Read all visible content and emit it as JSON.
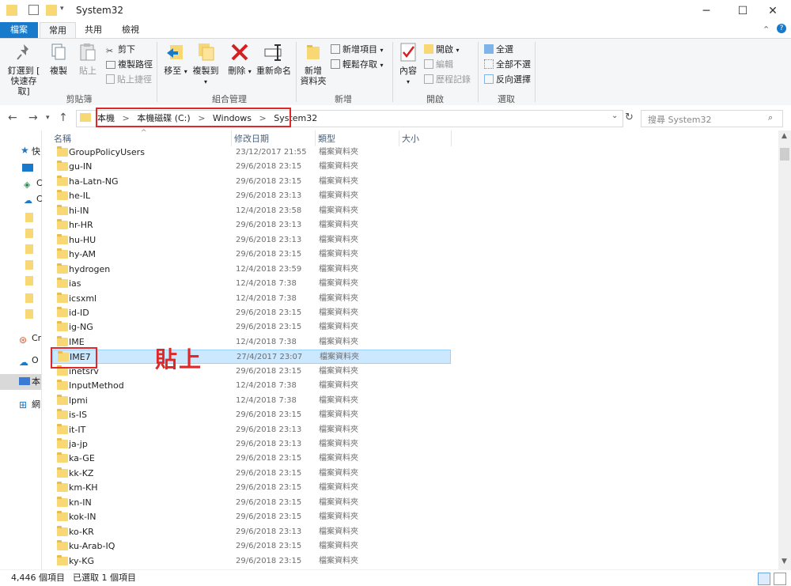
{
  "window": {
    "title": "System32"
  },
  "ribbon_tabs": {
    "file": "檔案",
    "home": "常用",
    "share": "共用",
    "view": "檢視"
  },
  "ribbon": {
    "clipboard": {
      "pin_line1": "釘選到 [",
      "pin_line2": "快速存取]",
      "copy": "複製",
      "paste": "貼上",
      "cut": "剪下",
      "copy_path": "複製路徑",
      "paste_shortcut": "貼上捷徑",
      "label": "剪貼簿"
    },
    "organize": {
      "move_to": "移至",
      "copy_to": "複製到",
      "delete": "刪除",
      "rename": "重新命名",
      "label": "組合管理"
    },
    "new": {
      "new_folder_line1": "新增",
      "new_folder_line2": "資料夾",
      "new_item": "新增項目",
      "easy_access": "輕鬆存取",
      "label": "新增"
    },
    "open": {
      "properties": "內容",
      "open": "開啟",
      "edit": "編輯",
      "history": "歷程記錄",
      "label": "開啟"
    },
    "select": {
      "select_all": "全選",
      "select_none": "全部不選",
      "invert": "反向選擇",
      "label": "選取"
    }
  },
  "address": {
    "crumbs": [
      "本機",
      "本機磁碟 (C:)",
      "Windows",
      "System32"
    ],
    "separator": ">",
    "search_placeholder": "搜尋 System32"
  },
  "nav_pane": {
    "items": [
      "快",
      "",
      "C",
      "C",
      "",
      "",
      "",
      "",
      "",
      "",
      "",
      "",
      "Cr",
      "O",
      "本",
      "網"
    ]
  },
  "columns": {
    "name": "名稱",
    "modified": "修改日期",
    "type": "類型",
    "size": "大小"
  },
  "files": [
    {
      "name": "GroupPolicyUsers",
      "date": "23/12/2017 21:55",
      "type": "檔案資料夾"
    },
    {
      "name": "gu-IN",
      "date": "29/6/2018 23:15",
      "type": "檔案資料夾"
    },
    {
      "name": "ha-Latn-NG",
      "date": "29/6/2018 23:15",
      "type": "檔案資料夾"
    },
    {
      "name": "he-IL",
      "date": "29/6/2018 23:13",
      "type": "檔案資料夾"
    },
    {
      "name": "hi-IN",
      "date": "12/4/2018 23:58",
      "type": "檔案資料夾"
    },
    {
      "name": "hr-HR",
      "date": "29/6/2018 23:13",
      "type": "檔案資料夾"
    },
    {
      "name": "hu-HU",
      "date": "29/6/2018 23:13",
      "type": "檔案資料夾"
    },
    {
      "name": "hy-AM",
      "date": "29/6/2018 23:15",
      "type": "檔案資料夾"
    },
    {
      "name": "hydrogen",
      "date": "12/4/2018 23:59",
      "type": "檔案資料夾"
    },
    {
      "name": "ias",
      "date": "12/4/2018 7:38",
      "type": "檔案資料夾"
    },
    {
      "name": "icsxml",
      "date": "12/4/2018 7:38",
      "type": "檔案資料夾"
    },
    {
      "name": "id-ID",
      "date": "29/6/2018 23:15",
      "type": "檔案資料夾"
    },
    {
      "name": "ig-NG",
      "date": "29/6/2018 23:15",
      "type": "檔案資料夾"
    },
    {
      "name": "IME",
      "date": "12/4/2018 7:38",
      "type": "檔案資料夾"
    },
    {
      "name": "IME7",
      "date": "27/4/2017 23:07",
      "type": "檔案資料夾",
      "selected": true
    },
    {
      "name": "inetsrv",
      "date": "29/6/2018 23:15",
      "type": "檔案資料夾"
    },
    {
      "name": "InputMethod",
      "date": "12/4/2018 7:38",
      "type": "檔案資料夾"
    },
    {
      "name": "lpmi",
      "date": "12/4/2018 7:38",
      "type": "檔案資料夾"
    },
    {
      "name": "is-IS",
      "date": "29/6/2018 23:15",
      "type": "檔案資料夾"
    },
    {
      "name": "it-IT",
      "date": "29/6/2018 23:13",
      "type": "檔案資料夾"
    },
    {
      "name": "ja-jp",
      "date": "29/6/2018 23:13",
      "type": "檔案資料夾"
    },
    {
      "name": "ka-GE",
      "date": "29/6/2018 23:15",
      "type": "檔案資料夾"
    },
    {
      "name": "kk-KZ",
      "date": "29/6/2018 23:15",
      "type": "檔案資料夾"
    },
    {
      "name": "km-KH",
      "date": "29/6/2018 23:15",
      "type": "檔案資料夾"
    },
    {
      "name": "kn-IN",
      "date": "29/6/2018 23:15",
      "type": "檔案資料夾"
    },
    {
      "name": "kok-IN",
      "date": "29/6/2018 23:15",
      "type": "檔案資料夾"
    },
    {
      "name": "ko-KR",
      "date": "29/6/2018 23:13",
      "type": "檔案資料夾"
    },
    {
      "name": "ku-Arab-IQ",
      "date": "29/6/2018 23:15",
      "type": "檔案資料夾"
    },
    {
      "name": "ky-KG",
      "date": "29/6/2018 23:15",
      "type": "檔案資料夾"
    }
  ],
  "annotation": {
    "paste_note": "貼上"
  },
  "status": {
    "item_count": "4,446 個項目",
    "selected": "已選取 1 個項目"
  },
  "colors": {
    "accent": "#1979ca",
    "highlight_red": "#e02828",
    "selection": "#cce8ff",
    "folder": "#f8d775"
  }
}
